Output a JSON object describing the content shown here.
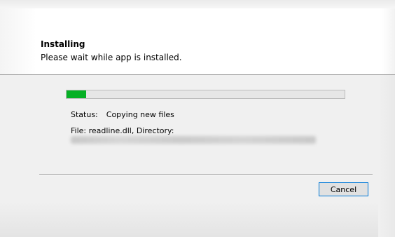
{
  "header": {
    "title": "Installing",
    "subtitle": "Please wait while app is installed."
  },
  "progress": {
    "fraction": 0.07,
    "color": "#06b025"
  },
  "status": {
    "label": "Status:",
    "value": "Copying new files"
  },
  "file": {
    "text": "File: readline.dll,  Directory:"
  },
  "buttons": {
    "cancel_label": "Cancel",
    "focus_color": "#0078d7"
  }
}
